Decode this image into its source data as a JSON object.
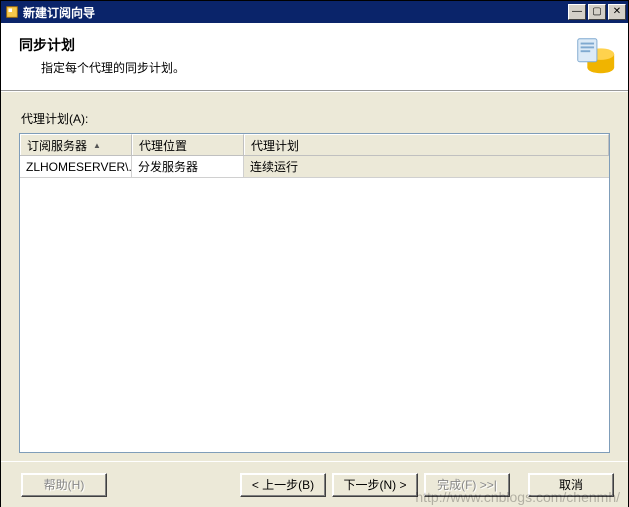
{
  "window": {
    "title": "新建订阅向导",
    "min_glyph": "—",
    "max_glyph": "▢",
    "close_glyph": "✕"
  },
  "header": {
    "title": "同步计划",
    "subtitle": "指定每个代理的同步计划。"
  },
  "field_label": "代理计划(A):",
  "grid": {
    "columns": [
      "订阅服务器",
      "代理位置",
      "代理计划"
    ],
    "sort_column_index": 0,
    "sort_glyph": "▲",
    "rows": [
      {
        "subscriber": "ZLHOMESERVER\\...",
        "location": "分发服务器",
        "schedule": "连续运行"
      }
    ]
  },
  "buttons": {
    "help": "帮助(H)",
    "back": "< 上一步(B)",
    "next": "下一步(N) >",
    "finish": "完成(F) >>|",
    "cancel": "取消"
  },
  "watermark": "http://www.cnblogs.com/chenmh/"
}
